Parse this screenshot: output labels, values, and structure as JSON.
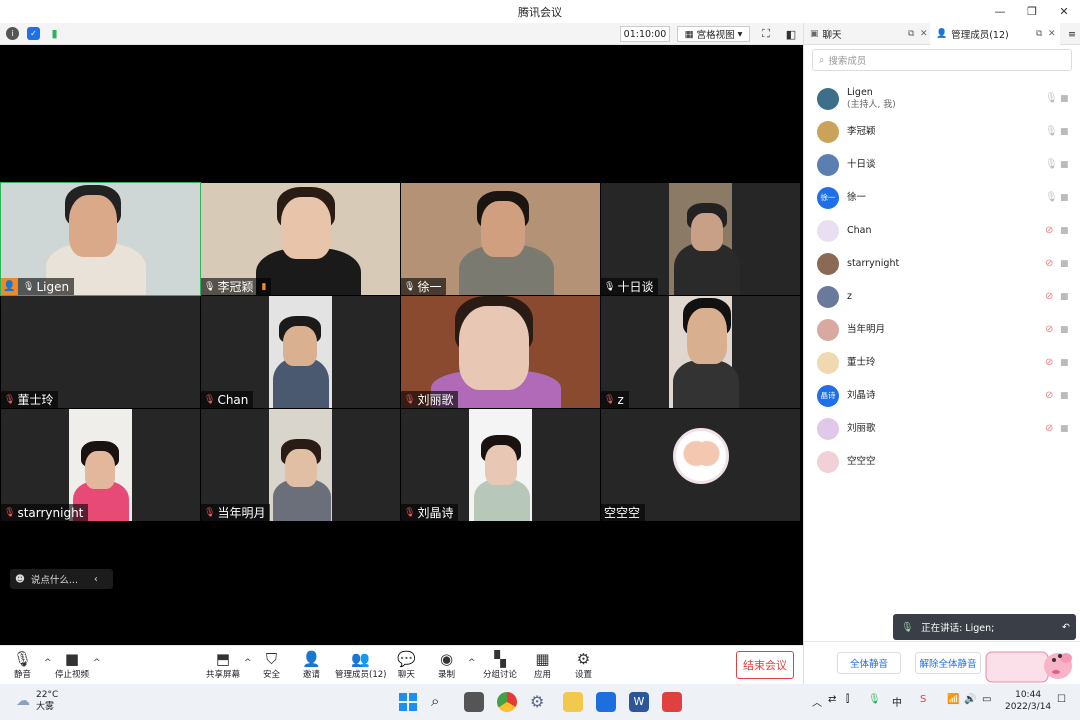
{
  "window": {
    "title": "腾讯会议",
    "minimize": "—",
    "restore": "❐",
    "close": "✕"
  },
  "toolbar": {
    "timer": "01:10:00",
    "view_label": "宫格视图"
  },
  "tiles": [
    {
      "name": "Ligen",
      "muted": false,
      "host": true,
      "network": false
    },
    {
      "name": "李冠颖",
      "muted": false,
      "host": false,
      "network": true
    },
    {
      "name": "徐一",
      "muted": false,
      "host": false,
      "network": false
    },
    {
      "name": "十日谈",
      "muted": false,
      "host": false,
      "network": false
    },
    {
      "name": "董士玲",
      "muted": true,
      "host": false,
      "network": false
    },
    {
      "name": "Chan",
      "muted": true,
      "host": false,
      "network": false
    },
    {
      "name": "刘丽歌",
      "muted": true,
      "host": false,
      "network": false
    },
    {
      "name": "z",
      "muted": true,
      "host": false,
      "network": false
    },
    {
      "name": "starrynight",
      "muted": true,
      "host": false,
      "network": false
    },
    {
      "name": "当年明月",
      "muted": true,
      "host": false,
      "network": false
    },
    {
      "name": "刘晶诗",
      "muted": true,
      "host": false,
      "network": false
    },
    {
      "name": "空空空",
      "muted": false,
      "host": false,
      "network": false,
      "no_mic": true
    }
  ],
  "chat_input": {
    "placeholder": "说点什么..."
  },
  "bottom_toolbar": {
    "mute": "静音",
    "stop_video": "停止视频",
    "share_screen": "共享屏幕",
    "security": "安全",
    "invite": "邀请",
    "manage_members": "管理成员(12)",
    "chat": "聊天",
    "record": "录制",
    "breakout": "分组讨论",
    "apps": "应用",
    "settings": "设置",
    "end_meeting": "结束会议"
  },
  "panel": {
    "tab_chat": "聊天",
    "tab_members": "管理成员(12)",
    "search_placeholder": "搜索成员",
    "members": [
      {
        "name": "Ligen",
        "sub": "(主持人, 我)",
        "muted": false,
        "avatar": "#3d6e8a"
      },
      {
        "name": "李冠颖",
        "sub": "",
        "muted": false,
        "avatar": "#c9a35a"
      },
      {
        "name": "十日谈",
        "sub": "",
        "muted": false,
        "avatar": "#5b7fb0"
      },
      {
        "name": "徐一",
        "sub": "",
        "muted": false,
        "avatar": "#1e6fe8",
        "avatar_text": "徐一"
      },
      {
        "name": "Chan",
        "sub": "",
        "muted": true,
        "avatar": "#e8dff0"
      },
      {
        "name": "starrynight",
        "sub": "",
        "muted": true,
        "avatar": "#8a6a55"
      },
      {
        "name": "z",
        "sub": "",
        "muted": true,
        "avatar": "#6a7a9a"
      },
      {
        "name": "当年明月",
        "sub": "",
        "muted": true,
        "avatar": "#d9a8a0"
      },
      {
        "name": "董士玲",
        "sub": "",
        "muted": true,
        "avatar": "#f0d8b0"
      },
      {
        "name": "刘晶诗",
        "sub": "",
        "muted": true,
        "avatar": "#1e6fe8",
        "avatar_text": "晶诗"
      },
      {
        "name": "刘丽歌",
        "sub": "",
        "muted": true,
        "avatar": "#e0c8e8"
      },
      {
        "name": "空空空",
        "sub": "",
        "muted": false,
        "no_mic": true,
        "avatar": "#f2d0d8"
      }
    ],
    "speaking": "正在讲话: Ligen;",
    "mute_all": "全体静音",
    "unmute_all": "解除全体静音"
  },
  "taskbar": {
    "temperature": "22°C",
    "weather": "大雾",
    "ime": "中",
    "time": "10:44",
    "date": "2022/3/14"
  },
  "colors": {
    "accent": "#1f6fe5",
    "danger": "#e54040",
    "active_speaker_border": "#2fb35a"
  }
}
